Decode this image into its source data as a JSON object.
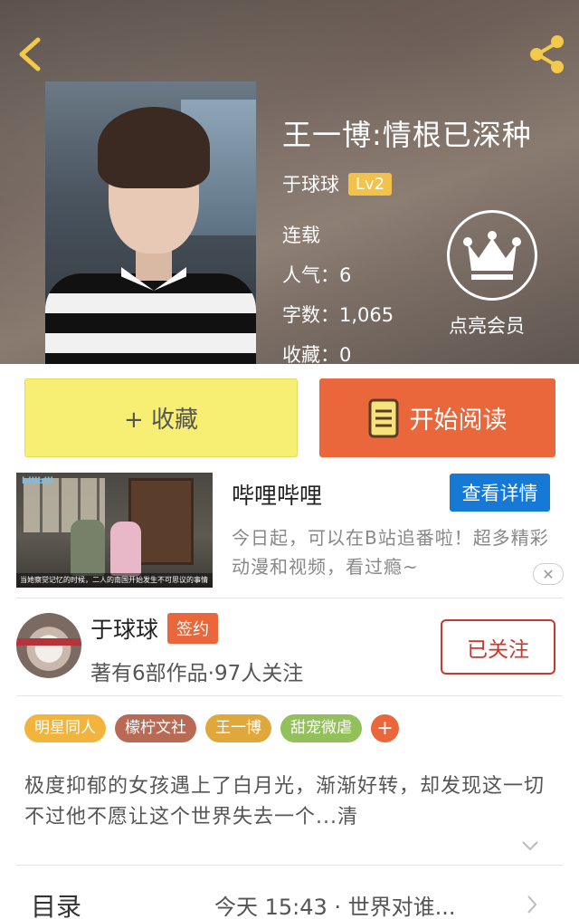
{
  "book": {
    "title": "王一博:情根已深种",
    "author": "于球球",
    "level": "Lv2",
    "status": "连载",
    "popularity": "人气：6",
    "word_count": "字数：1,065",
    "favorites": "收藏：0",
    "vip_label": "点亮会员"
  },
  "actions": {
    "collect_label": "+ 收藏",
    "read_label": "开始阅读"
  },
  "ad": {
    "title": "哔哩哔哩",
    "detail_label": "查看详情",
    "description": "今日起，可以在B站追番啦！超多精彩动漫和视频，看过瘾~",
    "thumb_logo": "bilibili",
    "thumb_caption": "当她察觉记忆的时候，二人的南国开始发生不可思议的事情",
    "close_label": "✕"
  },
  "author": {
    "name": "于球球",
    "badge": "签约",
    "stats": "著有6部作品·97人关注",
    "follow_label": "已关注"
  },
  "tags": [
    {
      "label": "明星同人",
      "color": "#f2b43d"
    },
    {
      "label": "檬柠文社",
      "color": "#b96a55"
    },
    {
      "label": "王一博",
      "color": "#e0a83a"
    },
    {
      "label": "甜宠微虐",
      "color": "#92c05a"
    },
    {
      "label": "+",
      "color": "#e9673a"
    }
  ],
  "summary": "极度抑郁的女孩遇上了白月光，渐渐好转，却发现这一切不过他不愿让这个世界失去一个...清",
  "toc": {
    "label": "目录",
    "latest": "今天 15:43 · 世界对谁..."
  },
  "colors": {
    "accent_orange": "#e9673a",
    "collect_yellow": "#f7ef73",
    "header_icon_yellow": "#f3c94a",
    "follow_red": "#c8382e",
    "ad_blue": "#1679d6"
  }
}
